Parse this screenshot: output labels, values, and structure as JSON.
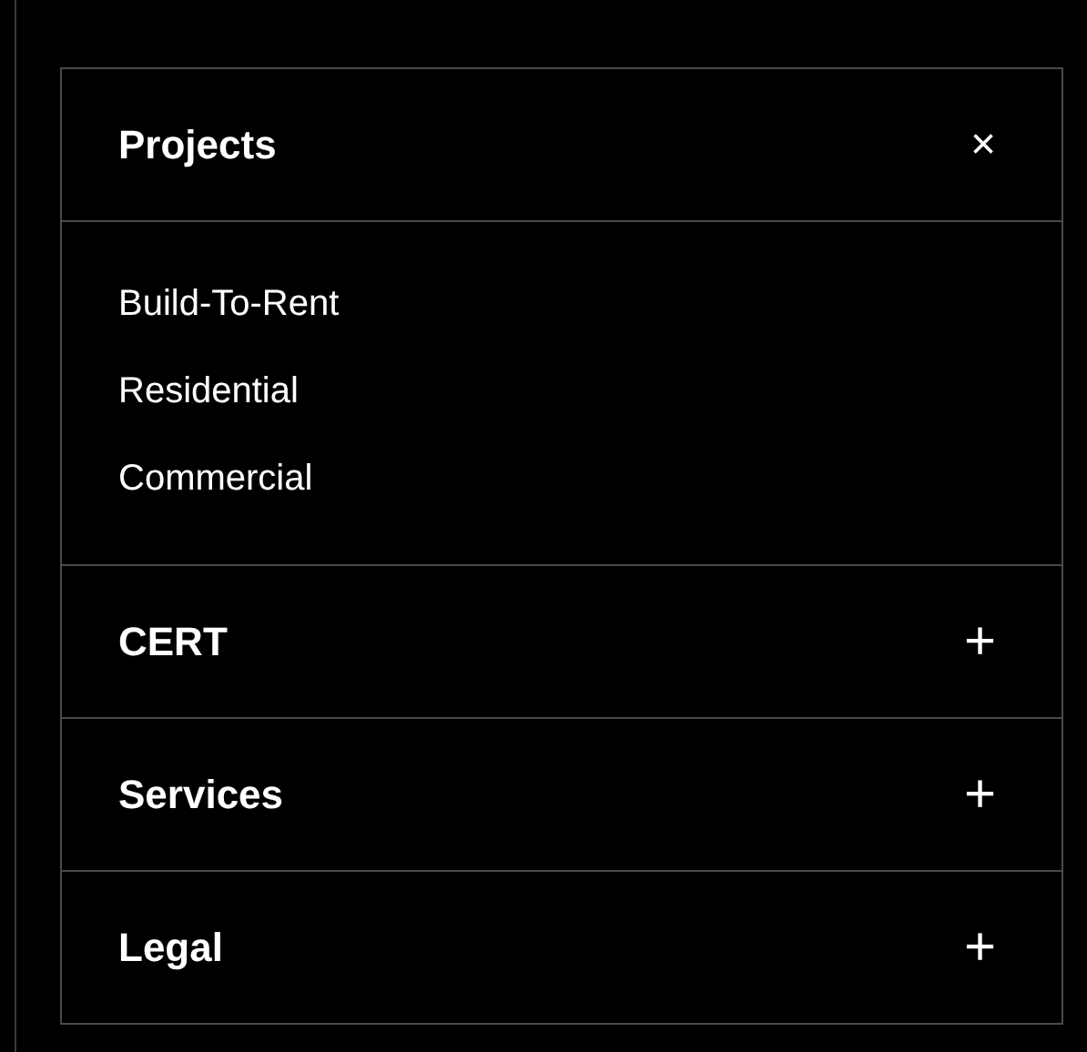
{
  "sections": [
    {
      "title": "Projects",
      "expanded": true,
      "icon": "×",
      "items": [
        "Build-To-Rent",
        "Residential",
        "Commercial"
      ]
    },
    {
      "title": "CERT",
      "expanded": false,
      "icon": "+"
    },
    {
      "title": "Services",
      "expanded": false,
      "icon": "+"
    },
    {
      "title": "Legal",
      "expanded": false,
      "icon": "+"
    }
  ]
}
